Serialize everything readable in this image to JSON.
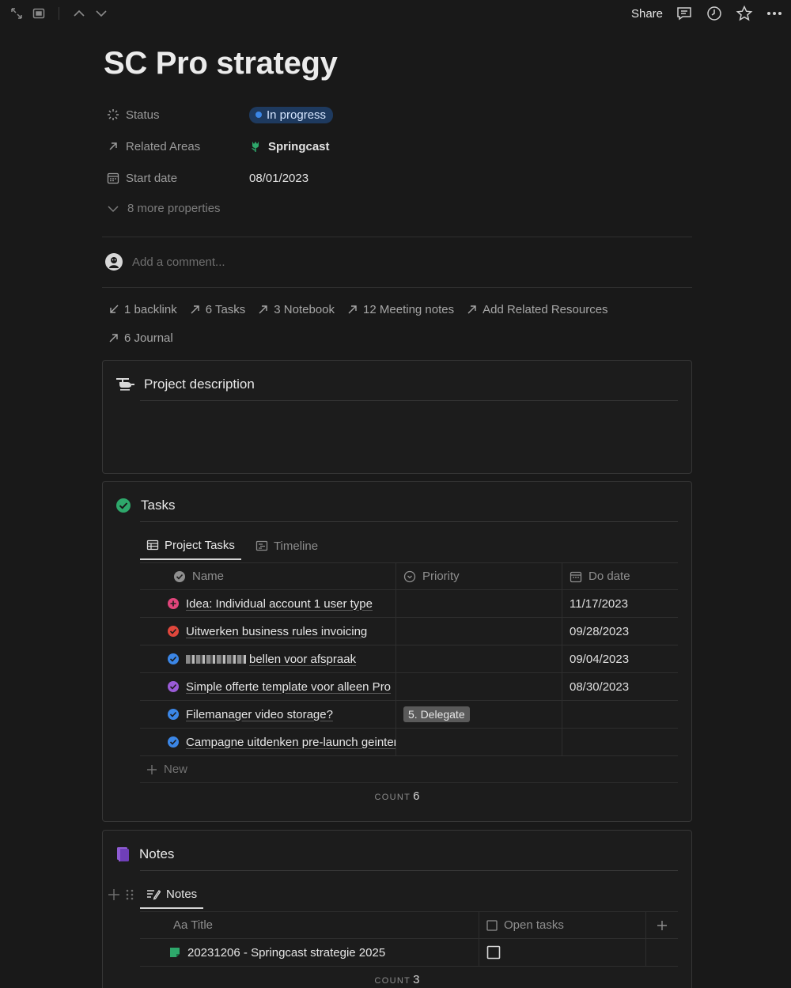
{
  "topbar": {
    "share_label": "Share"
  },
  "page": {
    "title": "SC Pro strategy"
  },
  "properties": {
    "status": {
      "label": "Status",
      "value": "In progress",
      "color": "#3b86e6"
    },
    "related_areas": {
      "label": "Related Areas",
      "value": "Springcast"
    },
    "start_date": {
      "label": "Start date",
      "value": "08/01/2023"
    },
    "more": "8 more properties"
  },
  "comment": {
    "placeholder": "Add a comment..."
  },
  "links": [
    {
      "label": "1 backlink",
      "icon": "arrow-down-left-icon"
    },
    {
      "label": "6 Tasks",
      "icon": "arrow-up-right-icon"
    },
    {
      "label": "3 Notebook",
      "icon": "arrow-up-right-icon"
    },
    {
      "label": "12 Meeting notes",
      "icon": "arrow-up-right-icon"
    },
    {
      "label": "Add Related Resources",
      "icon": "arrow-up-right-icon"
    },
    {
      "label": "6 Journal",
      "icon": "arrow-up-right-icon"
    }
  ],
  "project_description": {
    "title": "Project description"
  },
  "tasks": {
    "title": "Tasks",
    "tabs": [
      "Project Tasks",
      "Timeline"
    ],
    "columns": [
      "Name",
      "Priority",
      "Do date"
    ],
    "rows": [
      {
        "name": "Idea: Individual account 1 user type",
        "priority": "",
        "date": "11/17/2023",
        "color": "#e0457b"
      },
      {
        "name": "Uitwerken business rules invoicing",
        "priority": "",
        "date": "09/28/2023",
        "color": "#e0473c"
      },
      {
        "name": "bellen voor afspraak",
        "priority": "",
        "date": "09/04/2023",
        "color": "#3b86e6"
      },
      {
        "name": "Simple offerte template voor alleen Pro",
        "priority": "",
        "date": "08/30/2023",
        "color": "#9a5bd6"
      },
      {
        "name": "Filemanager video storage?",
        "priority": "5. Delegate",
        "date": "",
        "color": "#3b86e6"
      },
      {
        "name": "Campagne uitdenken pre-launch geintereseerden",
        "priority": "",
        "date": "",
        "color": "#3b86e6"
      }
    ],
    "new_label": "New",
    "count_label": "COUNT",
    "count_value": "6"
  },
  "notes": {
    "title": "Notes",
    "tab": "Notes",
    "columns": [
      "Aa Title",
      "Open tasks"
    ],
    "rows": [
      {
        "title": "20231206 - Springcast strategie 2025"
      }
    ],
    "count_label": "COUNT",
    "count_value": "3"
  },
  "colors": {
    "status_pill_bg": "#1e3a5f",
    "tasks_icon": "#2ea86b",
    "notes_icon": "#8f5cd4",
    "note_row_icon": "#2ea86b"
  }
}
